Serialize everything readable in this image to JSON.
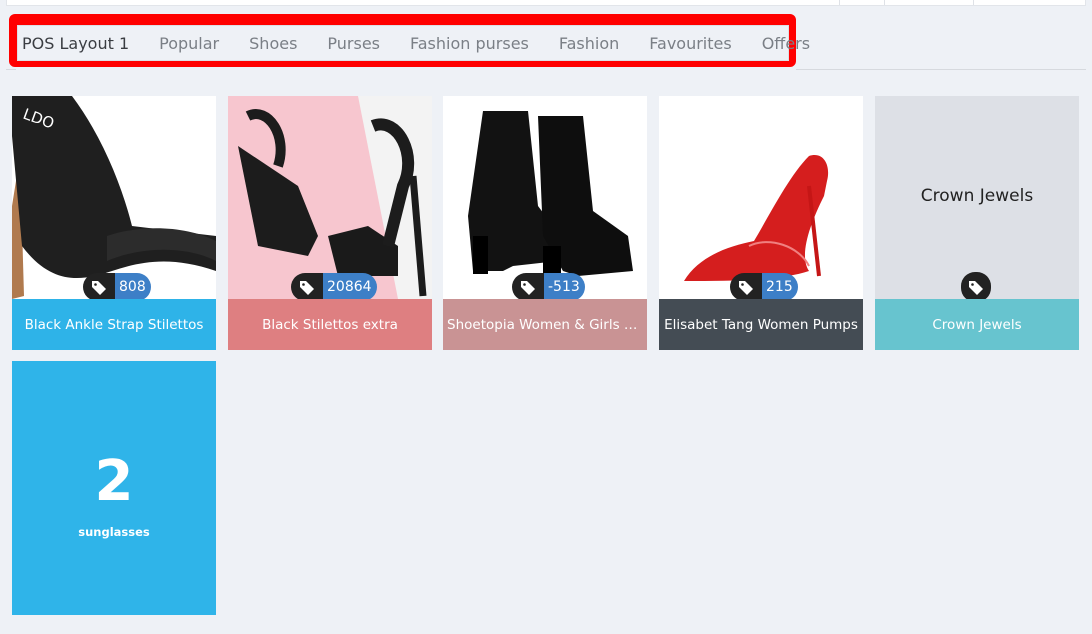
{
  "tabs": [
    {
      "label": "POS Layout 1"
    },
    {
      "label": "Popular"
    },
    {
      "label": "Shoes"
    },
    {
      "label": "Purses"
    },
    {
      "label": "Fashion purses"
    },
    {
      "label": "Fashion"
    },
    {
      "label": "Favourites"
    },
    {
      "label": "Offers"
    }
  ],
  "products": [
    {
      "name": "Black Ankle Strap Stilettos",
      "badge": "808",
      "color": "#2eb3e8"
    },
    {
      "name": "Black Stilettos extra",
      "badge": "20864",
      "color": "#de7f81"
    },
    {
      "name": "Shoetopia Women & Girls L...",
      "badge": "-513",
      "color": "#c99394"
    },
    {
      "name": "Elisabet Tang Women Pumps",
      "badge": "215",
      "color": "#444c54"
    },
    {
      "name": "Crown Jewels",
      "title": "Crown Jewels",
      "color": "#67c4cf"
    }
  ],
  "category": {
    "count": "2",
    "label": "sunglasses",
    "color": "#2fb4e9"
  },
  "icons": {
    "tag": "tag-icon"
  },
  "colors": {
    "highlight": "#ff0000",
    "badge": "#3d7fc7",
    "tag_button": "#222222"
  }
}
